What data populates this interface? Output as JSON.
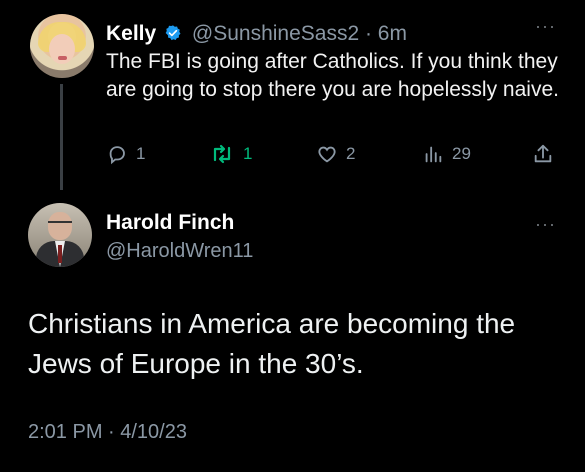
{
  "tweet1": {
    "name": "Kelly",
    "handle_time": "@SunshineSass2 · 6m",
    "text": "The FBI is going after Catholics. If you think they are going to stop there you are hopelessly naive.",
    "more": "···",
    "actions": {
      "replies": "1",
      "retweets": "1",
      "likes": "2",
      "views": "29"
    },
    "colors": {
      "verified": "#1d9bf0",
      "retweet": "#00ba7c"
    }
  },
  "tweet2": {
    "name": "Harold Finch",
    "handle": "@HaroldWren11",
    "more": "···",
    "text": "Christians in America are becoming the Jews of Europe in the 30’s.",
    "timestamp": "2:01 PM · 4/10/23"
  }
}
